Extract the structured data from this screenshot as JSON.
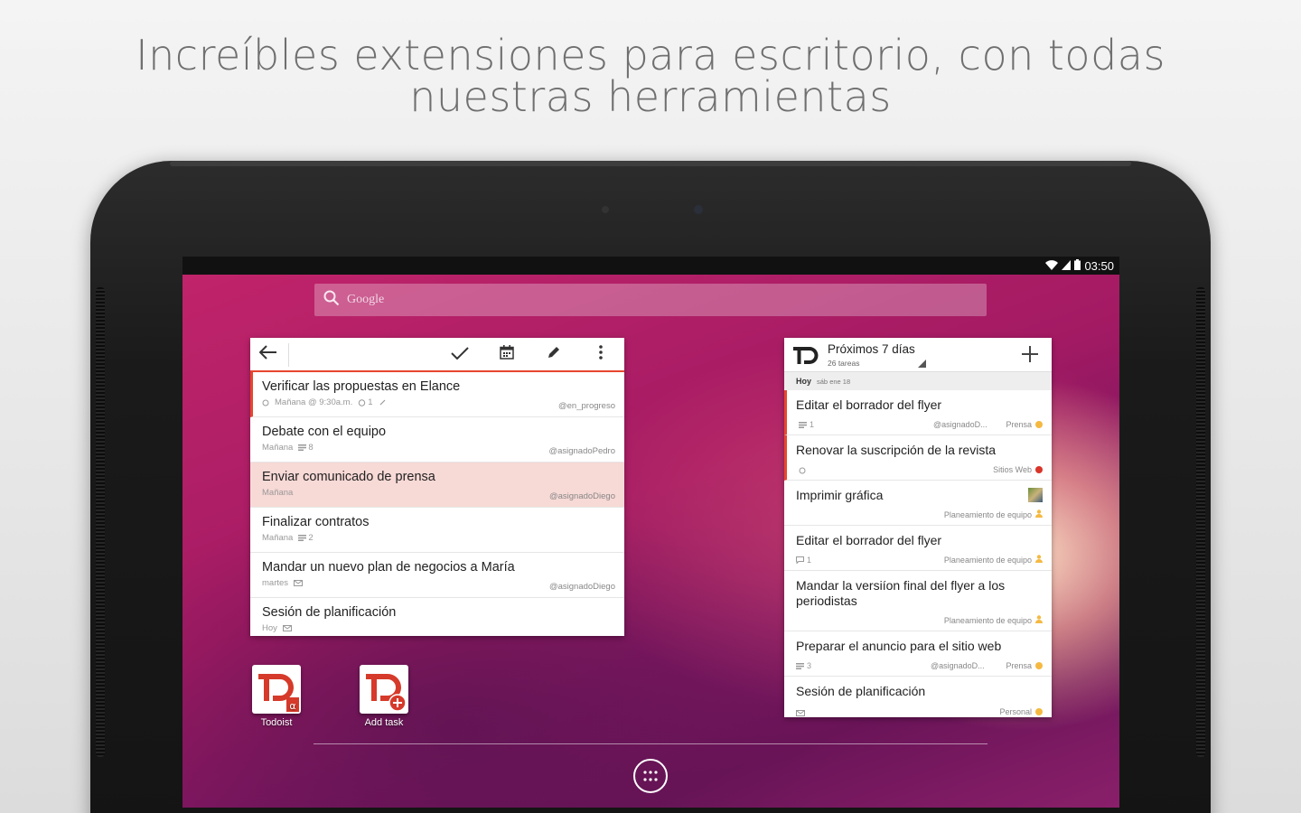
{
  "headline": {
    "line1": "Increíbles extensiones para escritorio, con todas",
    "line2": "nuestras herramientas"
  },
  "statusbar": {
    "time": "03:50",
    "icons": [
      "wifi-icon",
      "signal-icon",
      "battery-icon"
    ]
  },
  "search": {
    "placeholder": "Google",
    "icon": "search-icon"
  },
  "left_widget": {
    "toolbar": {
      "back_icon": "arrow-left-icon",
      "complete_icon": "check-icon",
      "calendar_icon": "calendar-icon",
      "edit_icon": "pencil-icon",
      "more_icon": "more-vert-icon"
    },
    "tasks": [
      {
        "title": "Verificar las propuestas en Elance",
        "date": "Mañana @ 9:30a.m.",
        "reminders": "1",
        "right": "@en_progreso"
      },
      {
        "title": "Debate con el equipo",
        "date": "Mañana",
        "comments": "8",
        "right": "@asignadoPedro"
      },
      {
        "title": "Enviar comunicado de prensa",
        "date": "Mañana",
        "right": "@asignadoDiego"
      },
      {
        "title": "Finalizar contratos",
        "date": "Mañana",
        "comments": "2",
        "right": ""
      },
      {
        "title": "Mandar un nuevo plan de negocios a María",
        "date": "martes",
        "right": "@asignadoDiego"
      },
      {
        "title": "Sesión de planificación",
        "date": "Hoy",
        "right": ""
      }
    ]
  },
  "right_widget": {
    "title": "Próximos 7 días",
    "subtitle": "26 tareas",
    "add_icon": "plus-icon",
    "section": {
      "label": "Hoy",
      "date": "sáb ene 18"
    },
    "tasks": [
      {
        "title": "Editar el borrador del flyer",
        "comments": "1",
        "label": "@asignadoD...",
        "project": "Prensa",
        "project_color": "#f5b942"
      },
      {
        "title": "Renovar la suscripción de la revista",
        "project": "Sitios Web",
        "project_color": "#d9352a"
      },
      {
        "title": "Imprimir gráfica",
        "project": "Planeamiento de equipo"
      },
      {
        "title": "Editar el borrador del flyer",
        "comments": "1",
        "project": "Planeamiento de equipo"
      },
      {
        "title": "Mandar la versiíon final del flyer a los periodistas",
        "project": "Planeamiento de equipo"
      },
      {
        "title": "Preparar el anuncio para el sitio web",
        "comments": "3",
        "label": "@asignadoD...",
        "project": "Prensa",
        "project_color": "#f5b942"
      },
      {
        "title": "Sesión de planificación",
        "project": "Personal",
        "project_color": "#f5b942"
      }
    ]
  },
  "home": {
    "apps": [
      {
        "label": "Todoist",
        "icon": "todoist-icon"
      },
      {
        "label": "Add task",
        "icon": "todoist-add-icon"
      }
    ],
    "app_drawer_icon": "apps-grid-icon"
  },
  "colors": {
    "accent": "#e8452f",
    "highlight": "#f7d9d6",
    "person": "#f5b942"
  }
}
